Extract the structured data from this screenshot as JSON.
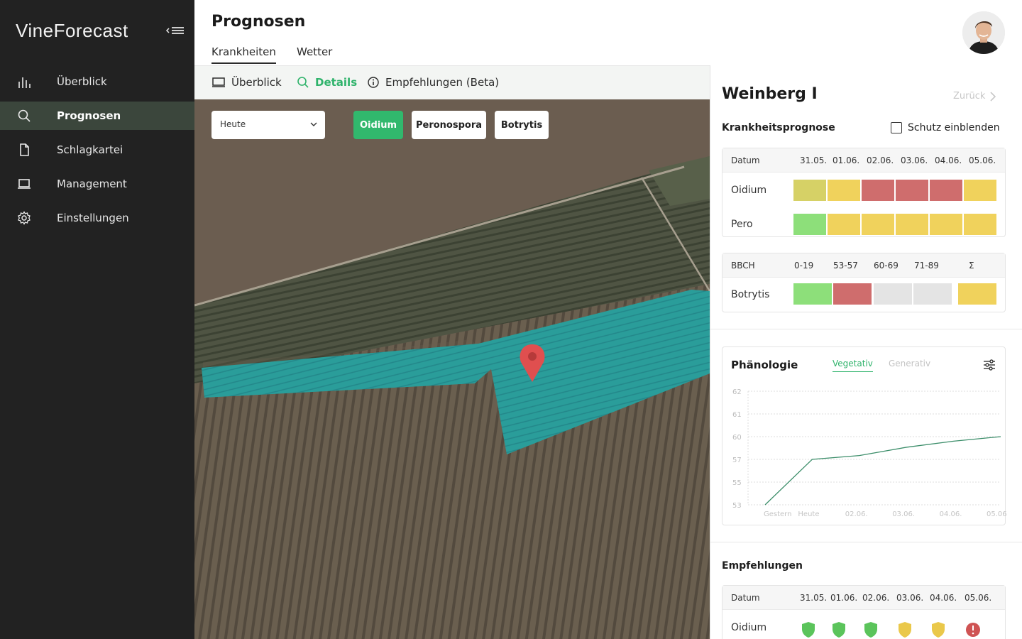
{
  "sidebar": {
    "logo": "VineForecast",
    "items": [
      {
        "label": "Überblick",
        "icon": "bar-chart-icon",
        "active": false
      },
      {
        "label": "Prognosen",
        "icon": "search-icon",
        "active": true
      },
      {
        "label": "Schlagkartei",
        "icon": "document-icon",
        "active": false
      },
      {
        "label": "Management",
        "icon": "laptop-icon",
        "active": false
      },
      {
        "label": "Einstellungen",
        "icon": "gear-icon",
        "active": false
      }
    ]
  },
  "header": {
    "title": "Prognosen",
    "tabs": [
      {
        "label": "Krankheiten",
        "active": true
      },
      {
        "label": "Wetter",
        "active": false
      }
    ]
  },
  "subtabs": [
    {
      "label": "Überblick",
      "icon": "monitor-icon",
      "active": false
    },
    {
      "label": "Details",
      "icon": "search-icon",
      "active": true
    },
    {
      "label": "Empfehlungen (Beta)",
      "icon": "info-icon",
      "active": false
    }
  ],
  "map": {
    "day_select": "Heute",
    "filters": [
      {
        "label": "Oidium",
        "active": true
      },
      {
        "label": "Peronospora",
        "active": false
      },
      {
        "label": "Botrytis",
        "active": false
      }
    ]
  },
  "panel": {
    "field_name": "Weinberg I",
    "back_label": "Zurück",
    "forecast_heading": "Krankheitsprognose",
    "protect_label": "Schutz einblenden",
    "forecast_table": {
      "head_label": "Datum",
      "dates": [
        "31.05.",
        "01.06.",
        "02.06.",
        "03.06.",
        "04.06.",
        "05.06."
      ],
      "rows": [
        {
          "label": "Oidium",
          "levels": [
            "olive",
            "yellow",
            "red",
            "red",
            "red",
            "yellow"
          ]
        },
        {
          "label": "Pero",
          "levels": [
            "green",
            "yellow",
            "yellow",
            "yellow",
            "yellow",
            "yellow"
          ]
        }
      ]
    },
    "bbch_table": {
      "head_label": "BBCH",
      "stages": [
        "0-19",
        "53-57",
        "60-69",
        "71-89",
        "Σ"
      ],
      "rows": [
        {
          "label": "Botrytis",
          "levels": [
            "green",
            "red",
            "grey",
            "grey",
            "yellow"
          ]
        }
      ]
    },
    "phenology": {
      "title": "Phänologie",
      "tabs": [
        {
          "label": "Vegetativ",
          "active": true
        },
        {
          "label": "Generativ",
          "active": false
        }
      ]
    },
    "recommendations": {
      "heading": "Empfehlungen",
      "head_label": "Datum",
      "dates": [
        "31.05.",
        "01.06.",
        "02.06.",
        "03.06.",
        "04.06.",
        "05.06."
      ],
      "rows": [
        {
          "label": "Oidium",
          "status": [
            "shield-green",
            "shield-green",
            "shield-green",
            "shield-yellow",
            "shield-yellow",
            "alert-red"
          ]
        }
      ]
    }
  },
  "colors": {
    "accent": "#2fb36b",
    "sidebar_bg": "#222222",
    "active_nav_bg": "#3b463c",
    "risk_green": "#8ddf7a",
    "risk_yellow": "#f0d25c",
    "risk_olive": "#d6d166",
    "risk_red": "#cf6d6d",
    "risk_grey": "#e4e4e4",
    "field_overlay": "#2a9d9a"
  },
  "chart_data": {
    "type": "line",
    "x": [
      "Gestern",
      "Heute",
      "02.06.",
      "03.06.",
      "04.06.",
      "05.06."
    ],
    "yticks": [
      53,
      55,
      57,
      60,
      61,
      62
    ],
    "series": [
      {
        "values": [
          53,
          57,
          57.5,
          58.6,
          59.4,
          60
        ]
      }
    ],
    "ylim": [
      53,
      62
    ],
    "grid": true
  }
}
